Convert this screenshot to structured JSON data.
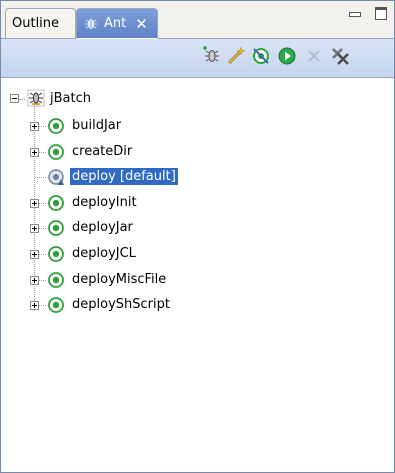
{
  "tabs": [
    {
      "label": "Outline",
      "active": false
    },
    {
      "label": "Ant",
      "active": true
    }
  ],
  "tree": {
    "root": {
      "label": "jBatch",
      "icon": "ant-bug-icon",
      "expanded": true
    },
    "targets": [
      {
        "label": "buildJar",
        "icon": "target-icon",
        "expandable": true,
        "selected": false
      },
      {
        "label": "createDir",
        "icon": "target-icon",
        "expandable": true,
        "selected": false
      },
      {
        "label": "deploy [default]",
        "icon": "default-target-icon",
        "expandable": false,
        "selected": true
      },
      {
        "label": "deployInit",
        "icon": "target-icon",
        "expandable": true,
        "selected": false
      },
      {
        "label": "deployJar",
        "icon": "target-icon",
        "expandable": true,
        "selected": false
      },
      {
        "label": "deployJCL",
        "icon": "target-icon",
        "expandable": true,
        "selected": false
      },
      {
        "label": "deployMiscFile",
        "icon": "target-icon",
        "expandable": true,
        "selected": false
      },
      {
        "label": "deployShScript",
        "icon": "target-icon",
        "expandable": true,
        "selected": false
      }
    ]
  },
  "toolbar": {
    "buttons": [
      {
        "name": "add-buildfile-button",
        "icon": "add-ant-icon",
        "enabled": true
      },
      {
        "name": "search-buildfile-button",
        "icon": "wand-icon",
        "enabled": true
      },
      {
        "name": "hide-internal-targets-button",
        "icon": "filter-target-icon",
        "enabled": true
      },
      {
        "name": "run-target-button",
        "icon": "run-icon",
        "enabled": true
      },
      {
        "name": "remove-button",
        "icon": "remove-icon",
        "enabled": false
      },
      {
        "name": "remove-all-button",
        "icon": "remove-all-icon",
        "enabled": true
      }
    ]
  },
  "colors": {
    "selection": "#316ac5",
    "active_tab": "#6f90d0",
    "toolbar": "#d0ddf2",
    "target_green": "#2e9e3e"
  }
}
